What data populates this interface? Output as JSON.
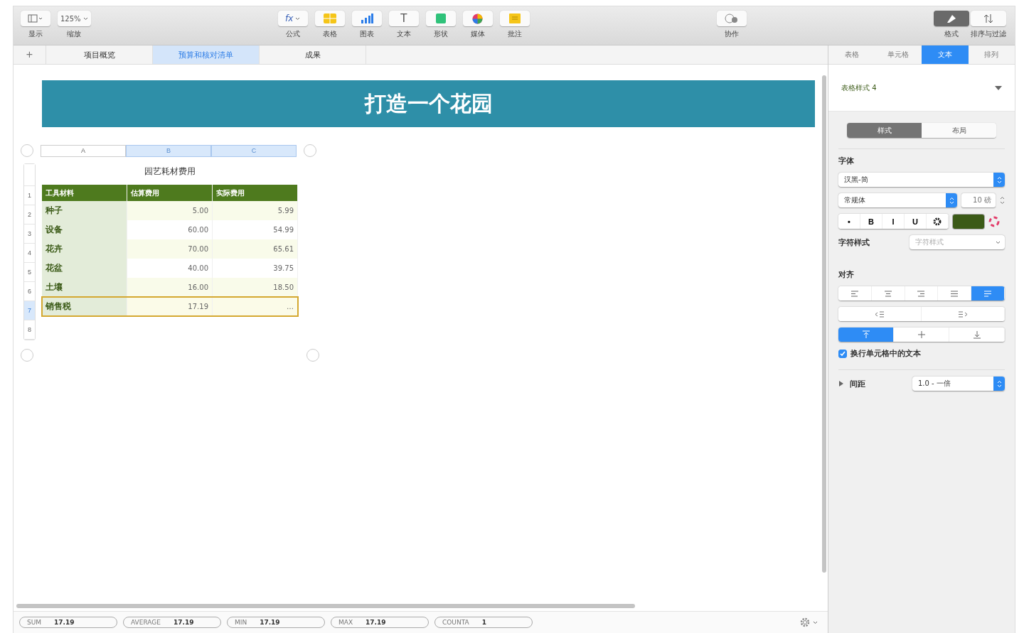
{
  "toolbar": {
    "left": [
      {
        "kind": "view",
        "label": "显示"
      },
      {
        "kind": "zoom",
        "value": "125%",
        "label": "缩放"
      }
    ],
    "center": [
      {
        "kind": "formula",
        "glyph": "fx",
        "label": "公式"
      },
      {
        "kind": "table",
        "label": "表格"
      },
      {
        "kind": "chart",
        "label": "图表"
      },
      {
        "kind": "text",
        "glyph": "T",
        "label": "文本"
      },
      {
        "kind": "shape",
        "label": "形状"
      },
      {
        "kind": "media",
        "label": "媒体"
      },
      {
        "kind": "comment",
        "label": "批注"
      }
    ],
    "collab": {
      "label": "协作"
    },
    "right": [
      {
        "kind": "format",
        "label": "格式",
        "selected": true
      },
      {
        "kind": "sort",
        "label": "排序与过滤",
        "selected": false
      }
    ]
  },
  "sheet_tabs": [
    {
      "label": "项目概览",
      "selected": false
    },
    {
      "label": "预算和核对清单",
      "selected": true
    },
    {
      "label": "成果",
      "selected": false
    }
  ],
  "add_sheet": "+",
  "banner": "打造一个花园",
  "table": {
    "title": "园艺耗材费用",
    "column_letters": [
      {
        "label": "A",
        "selected": false
      },
      {
        "label": "B",
        "selected": true
      },
      {
        "label": "C",
        "selected": true
      }
    ],
    "columns": [
      "工具材料",
      "估算费用",
      "实际费用"
    ],
    "rows": [
      {
        "number": "1",
        "selected": false,
        "kind": "header",
        "cells": []
      },
      {
        "number": "2",
        "selected": false,
        "cells": [
          "种子",
          "5.00",
          "5.99"
        ]
      },
      {
        "number": "3",
        "selected": false,
        "cells": [
          "设备",
          "60.00",
          "54.99"
        ]
      },
      {
        "number": "4",
        "selected": false,
        "cells": [
          "花卉",
          "70.00",
          "65.61"
        ]
      },
      {
        "number": "5",
        "selected": false,
        "cells": [
          "花盆",
          "40.00",
          "39.75"
        ]
      },
      {
        "number": "6",
        "selected": false,
        "cells": [
          "土壤",
          "16.00",
          "18.50"
        ]
      },
      {
        "number": "7",
        "selected": true,
        "cells": [
          "销售税",
          "17.19",
          "…"
        ]
      },
      {
        "number": "8",
        "selected": false,
        "cells": []
      }
    ]
  },
  "status_bar": [
    {
      "name": "SUM",
      "value": "17.19"
    },
    {
      "name": "AVERAGE",
      "value": "17.19"
    },
    {
      "name": "MIN",
      "value": "17.19"
    },
    {
      "name": "MAX",
      "value": "17.19"
    },
    {
      "name": "COUNTA",
      "value": "1"
    }
  ],
  "sidebar": {
    "tabs": [
      {
        "label": "表格",
        "selected": false
      },
      {
        "label": "单元格",
        "selected": false
      },
      {
        "label": "文本",
        "selected": true
      },
      {
        "label": "排列",
        "selected": false
      }
    ],
    "style_name": "表格样式 4",
    "segments": [
      {
        "label": "样式",
        "selected": true
      },
      {
        "label": "布局",
        "selected": false
      }
    ],
    "font_label": "字体",
    "font_family": "汉黑-简",
    "font_typeface": "常规体",
    "font_size": "10 磅",
    "text_buttons": [
      "•",
      "B",
      "I",
      "U"
    ],
    "char_style_label": "字符样式",
    "char_style_value": "字符样式",
    "align_label": "对齐",
    "align_buttons": [
      {
        "kind": "left",
        "selected": false
      },
      {
        "kind": "center",
        "selected": false
      },
      {
        "kind": "right",
        "selected": false
      },
      {
        "kind": "justify",
        "selected": false
      },
      {
        "kind": "auto",
        "selected": true
      }
    ],
    "indent_buttons": [
      {
        "kind": "decrease"
      },
      {
        "kind": "increase"
      }
    ],
    "valign_buttons": [
      {
        "kind": "top",
        "selected": true
      },
      {
        "kind": "middle",
        "selected": false
      },
      {
        "kind": "bottom",
        "selected": false
      }
    ],
    "wrap": {
      "label": "换行单元格中的文本",
      "checked": true
    },
    "spacing": {
      "label": "间距",
      "value": "1.0 - 一倍",
      "expanded": false
    }
  }
}
